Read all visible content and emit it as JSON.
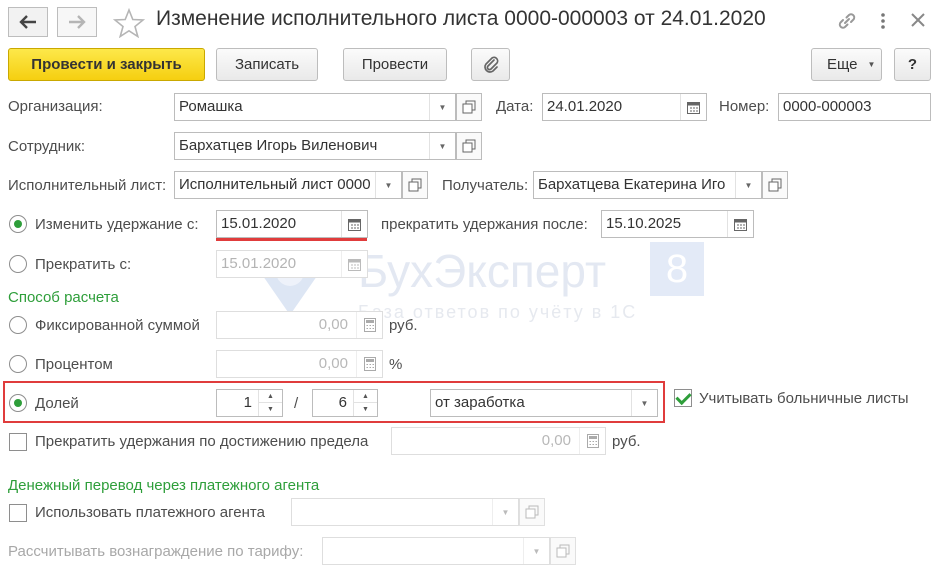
{
  "header": {
    "title": "Изменение исполнительного листа 0000-000003 от 24.01.2020",
    "back_icon": "arrow-left-icon",
    "forward_icon": "arrow-right-icon",
    "favorite_icon": "star-icon",
    "link_icon": "link-icon",
    "menu_icon": "kebab-menu-icon",
    "close_icon": "close-icon"
  },
  "toolbar": {
    "post_and_close": "Провести и закрыть",
    "save": "Записать",
    "post": "Провести",
    "attach_icon": "paperclip-icon",
    "more": "Еще",
    "help": "?"
  },
  "form": {
    "organization_label": "Организация:",
    "organization_value": "Ромашка",
    "date_label": "Дата:",
    "date_value": "24.01.2020",
    "number_label": "Номер:",
    "number_value": "0000-000003",
    "employee_label": "Сотрудник:",
    "employee_value": "Бархатцев Игорь Виленович",
    "writ_label": "Исполнительный лист:",
    "writ_value": "Исполнительный лист 0000",
    "recipient_label": "Получатель:",
    "recipient_value": "Бархатцева Екатерина Иго",
    "change_from_label": "Изменить удержание с:",
    "change_from_value": "15.01.2020",
    "stop_after_label": "прекратить удержания после:",
    "stop_after_value": "15.10.2025",
    "stop_from_label": "Прекратить с:",
    "stop_from_value": "15.01.2020"
  },
  "calc": {
    "section_title": "Способ расчета",
    "fixed_label": "Фиксированной суммой",
    "fixed_value": "0,00",
    "fixed_unit": "руб.",
    "percent_label": "Процентом",
    "percent_value": "0,00",
    "percent_unit": "%",
    "share_label": "Долей",
    "share_numerator": "1",
    "share_slash": "/",
    "share_denominator": "6",
    "share_base": "от заработка",
    "sick_leave_label": "Учитывать больничные листы",
    "limit_label": "Прекратить удержания по достижению предела",
    "limit_value": "0,00",
    "limit_unit": "руб."
  },
  "transfer": {
    "section_title": "Денежный перевод через платежного агента",
    "use_agent_label": "Использовать платежного агента",
    "tariff_label": "Рассчитывать вознаграждение по тарифу:"
  },
  "watermark": {
    "brand": "БухЭксперт",
    "brand_num": "8",
    "tagline": "База ответов по учёту в 1С"
  },
  "colors": {
    "accent_green": "#2e9e3a",
    "primary_yellow": "#f5cf10",
    "highlight_red": "#e03c3c"
  }
}
